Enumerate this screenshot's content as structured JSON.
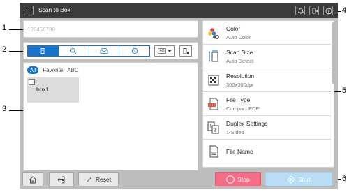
{
  "title_bar": {
    "menu_label": "···",
    "title": "Scan to Box"
  },
  "box_number_input": {
    "placeholder": "123456789"
  },
  "filter_tabs": [
    "All",
    "Favorite",
    "ABC"
  ],
  "boxes": [
    {
      "name": "box1"
    }
  ],
  "sort_dropdown": {
    "value": "AB"
  },
  "settings": [
    {
      "label": "Color",
      "value": "Auto Color",
      "icon": "color-icon"
    },
    {
      "label": "Scan Size",
      "value": "Auto Detect",
      "icon": "scan-size-icon"
    },
    {
      "label": "Resolution",
      "value": "300x300dpi",
      "icon": "resolution-icon"
    },
    {
      "label": "File Type",
      "value": "Compact PDF",
      "icon": "pdf-icon"
    },
    {
      "label": "Duplex Settings",
      "value": "1-Sided",
      "icon": "duplex-icon"
    },
    {
      "label": "File Name",
      "value": "",
      "icon": "file-name-icon"
    }
  ],
  "bottom_bar": {
    "reset_label": "Reset",
    "stop_label": "Stop",
    "start_label": "Start"
  },
  "callouts": [
    "1",
    "2",
    "3",
    "4",
    "5",
    "6"
  ],
  "colors": {
    "title_bar_bg": "#3b3b3b",
    "accent_blue": "#1a73c8",
    "stop_pink": "#f36d86",
    "start_light_blue": "#b9dcf7"
  }
}
